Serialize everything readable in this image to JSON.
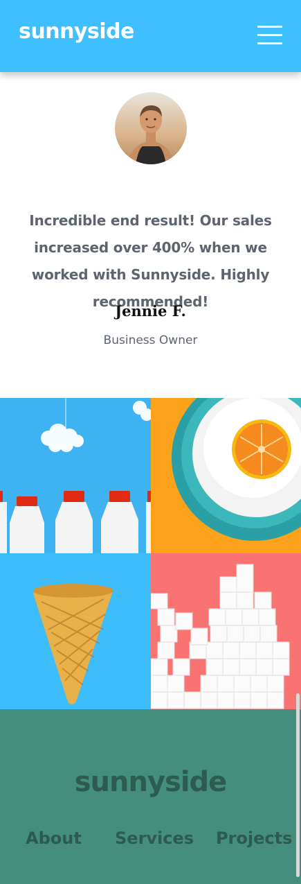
{
  "header": {
    "logo": "sunnyside",
    "menu_icon": "hamburger-menu-icon",
    "background": "#3ebfff"
  },
  "testimonial": {
    "quote": "Incredible end result! Our sales increased over 400% when we worked with Sunnyside. Highly recommended!",
    "name": "Jennie F.",
    "role": "Business Owner"
  },
  "gallery": {
    "items": [
      "milk-bottles-image",
      "orange-on-plate-image",
      "ice-cream-cone-image",
      "sugar-cubes-image"
    ]
  },
  "footer": {
    "logo": "sunnyside",
    "links": [
      "About",
      "Services",
      "Projects"
    ],
    "background": "#458d7c",
    "text_color": "#2c5b50"
  }
}
